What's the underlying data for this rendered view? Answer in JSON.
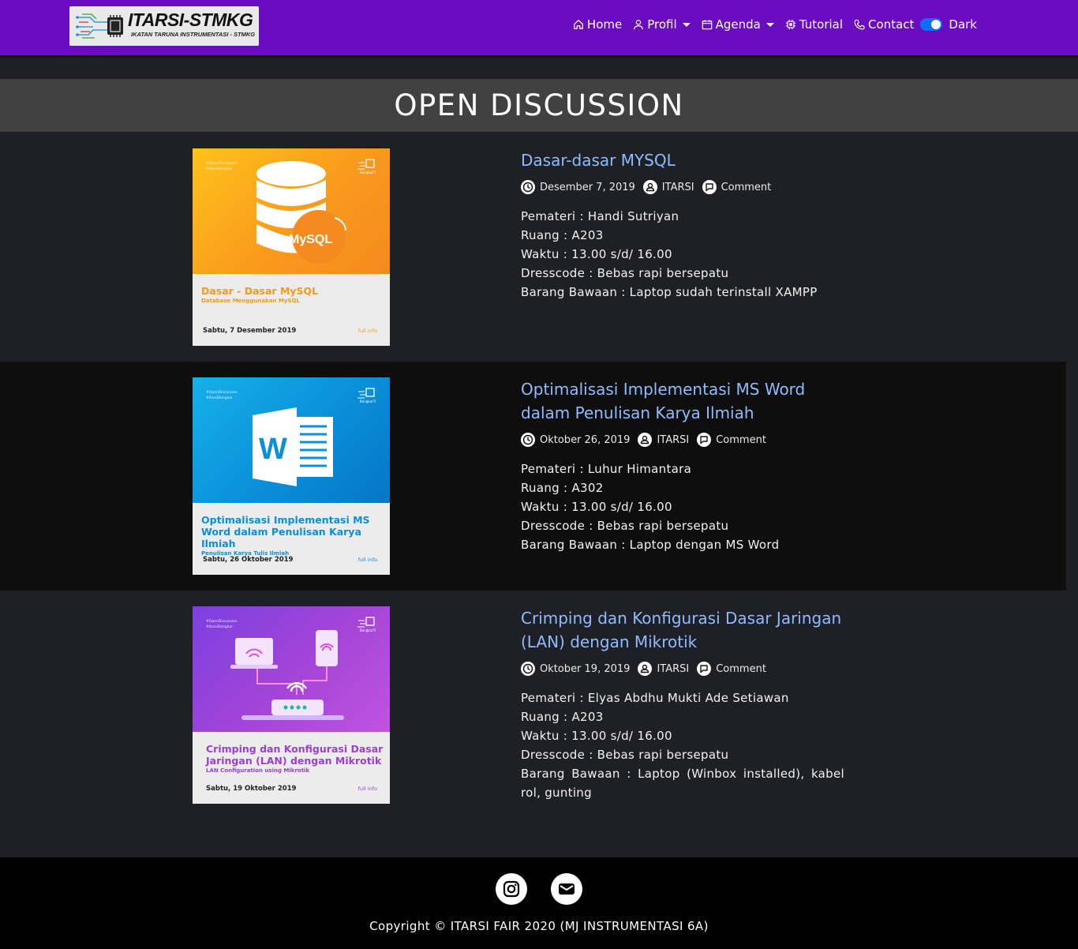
{
  "navbar": {
    "brand_title": "ITARSI-STMKG",
    "brand_subtitle": "IKATAN TARUNA INSTRUMENTASI - STMKG",
    "items": [
      {
        "label": "Home",
        "icon": "home-icon"
      },
      {
        "label": "Profil",
        "icon": "user-icon",
        "dropdown": true
      },
      {
        "label": "Agenda",
        "icon": "calendar-icon",
        "dropdown": true
      },
      {
        "label": "Tutorial",
        "icon": "chip-icon"
      },
      {
        "label": "Contact",
        "icon": "phone-icon"
      }
    ],
    "theme_toggle_label": "Dark",
    "theme_toggle_on": true,
    "accent": "#6a0dc1"
  },
  "page_title": "OPEN DISCUSSION",
  "posts": [
    {
      "title": "Dasar-dasar MYSQL",
      "date": "Desember 7, 2019",
      "author": "ITARSI",
      "comment_label": "Comment",
      "details": [
        "Pemateri : Handi Sutriyan",
        "Ruang : A203",
        "Waktu : 13.00 s/d/ 16.00",
        "Dresscode : Bebas rapi bersepatu",
        "Barang Bawaan : Laptop sudah terinstall XAMPP"
      ],
      "poster": {
        "hashtags": "#OpenDiscussion\n#ItarsiBongkar",
        "brand": "BongkarTI",
        "logo_text": "MySQL",
        "caption": "Dasar - Dasar MySQL",
        "subcaption": "Database Menggunakan MySQL",
        "date": "Sabtu, 7 Desember 2019",
        "full_info": "full info",
        "accent": "#f39a1e"
      }
    },
    {
      "title": "Optimalisasi Implementasi MS Word dalam Penulisan Karya Ilmiah",
      "date": "Oktober 26, 2019",
      "author": "ITARSI",
      "comment_label": "Comment",
      "details": [
        "Pemateri : Luhur Himantara",
        "Ruang : A302",
        "Waktu : 13.00 s/d/ 16.00",
        "Dresscode : Bebas rapi bersepatu",
        "Barang Bawaan : Laptop dengan MS Word"
      ],
      "poster": {
        "hashtags": "#OpenDiscussion\n#ItarsiBongkar",
        "brand": "BongkarTI",
        "logo_text": "W",
        "caption": "Optimalisasi Implementasi MS Word dalam Penulisan Karya Ilmiah",
        "subcaption": "Penulisan Karya Tulis Ilmiah",
        "date": "Sabtu, 26 Oktober 2019",
        "full_info": "full info",
        "accent": "#0a8fd8"
      }
    },
    {
      "title": "Crimping dan Konfigurasi Dasar Jaringan (LAN) dengan Mikrotik",
      "date": "Oktober 19, 2019",
      "author": "ITARSI",
      "comment_label": "Comment",
      "details": [
        "Pemateri : Elyas Abdhu Mukti Ade Setiawan",
        "Ruang : A203",
        "Waktu : 13.00 s/d/ 16.00",
        "Dresscode : Bebas rapi bersepatu",
        "Barang Bawaan : Laptop (Winbox installed), kabel rol, gunting"
      ],
      "poster": {
        "hashtags": "#OpenDiscussion\n#ItarsiBongkar",
        "brand": "BongkarTI",
        "logo_text": "",
        "caption": "Crimping dan Konfigurasi Dasar Jaringan (LAN) dengan Mikrotik",
        "subcaption": "LAN Configuration using Mikrotik",
        "date": "Sabtu, 19 Oktober 2019",
        "full_info": "full info",
        "accent": "#9b3fd0"
      }
    }
  ],
  "footer": {
    "social": [
      {
        "icon": "instagram-icon"
      },
      {
        "icon": "email-icon"
      }
    ],
    "copyright": "Copyright © ITARSI FAIR 2020 (MJ INSTRUMENTASI 6A)"
  }
}
